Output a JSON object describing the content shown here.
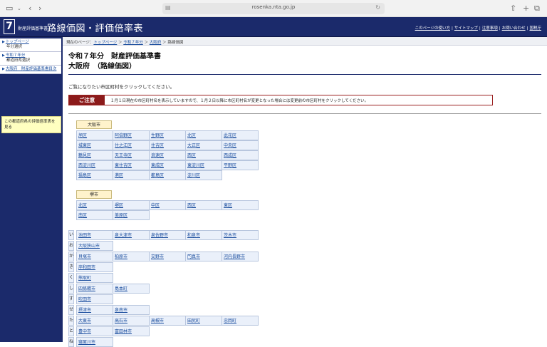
{
  "browser": {
    "url": "rosenka.nta.go.jp"
  },
  "header": {
    "logo_number": "7",
    "site_subtitle": "財産評価基準書",
    "site_title": "路線価図・評価倍率表",
    "nav": [
      "このページの使い方",
      "サイトマップ",
      "注意事項",
      "お問い合わせ",
      "国税庁"
    ]
  },
  "sidebar": {
    "items": [
      {
        "label": "トップページ",
        "sub": "年分選択"
      },
      {
        "label": "令和７年分",
        "sub": "都道府県選択"
      },
      {
        "label": "大阪府　財産評価基準書目次",
        "sub": ""
      }
    ],
    "note": "この都道府県の評価倍率表を見る"
  },
  "breadcrumb": {
    "prefix": "現在のページ：",
    "items": [
      "トップページ",
      "令和７年分",
      "大阪府",
      "路線価図"
    ]
  },
  "page": {
    "title_line1": "令和７年分　財産評価基準書",
    "title_line2": "大阪府　（路線価図）",
    "instruction": "ご覧になりたい市区町村をクリックしてください。",
    "notice_label": "ご注意",
    "notice_text": "１月１日現在の市区町村名を表示していますので、１月２日以降に市区町村名が変更となった場合には変更前の市区町村をクリックしてください。"
  },
  "osaka": {
    "label": "大阪市",
    "wards": [
      "旭区",
      "阿倍野区",
      "生野区",
      "北区",
      "此花区",
      "城東区",
      "住之江区",
      "住吉区",
      "大正区",
      "中央区",
      "鶴見区",
      "天王寺区",
      "浪速区",
      "西区",
      "西成区",
      "西淀川区",
      "東住吉区",
      "東成区",
      "東淀川区",
      "平野区",
      "福島区",
      "港区",
      "都島区",
      "淀川区"
    ]
  },
  "sakai": {
    "label": "堺市",
    "wards": [
      "北区",
      "堺区",
      "中区",
      "西区",
      "東区",
      "南区",
      "美原区"
    ]
  },
  "municipalities": [
    {
      "kana": "い",
      "names": [
        "池田市",
        "泉大津市",
        "泉佐野市",
        "和泉市",
        "茨木市"
      ]
    },
    {
      "kana": "お",
      "names": [
        "大阪狭山市"
      ]
    },
    {
      "kana": "か",
      "names": [
        "貝塚市",
        "柏原市",
        "交野市",
        "門真市",
        "河内長野市"
      ]
    },
    {
      "kana": "き",
      "names": [
        "岸和田市"
      ]
    },
    {
      "kana": "く",
      "names": [
        "熊取町"
      ]
    },
    {
      "kana": "し",
      "names": [
        "四條畷市",
        "島本町"
      ]
    },
    {
      "kana": "す",
      "names": [
        "吹田市"
      ]
    },
    {
      "kana": "せ",
      "names": [
        "摂津市",
        "泉南市"
      ]
    },
    {
      "kana": "た",
      "names": [
        "大東市",
        "高石市",
        "高槻市",
        "田尻町",
        "忠岡町"
      ]
    },
    {
      "kana": "と",
      "names": [
        "豊中市",
        "富田林市"
      ]
    },
    {
      "kana": "ね",
      "names": [
        "寝屋川市"
      ]
    }
  ]
}
